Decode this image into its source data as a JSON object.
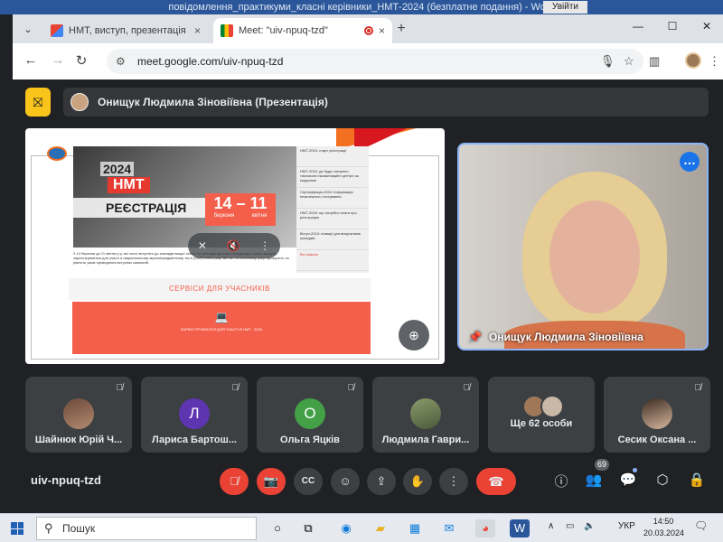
{
  "word": {
    "title": "повідомлення_практикуми_класні керівники_НМТ-2024 (безплатне подання) - Word",
    "signin": "Увійти"
  },
  "browser": {
    "tabs": [
      {
        "title": "НМТ, виступ, презентація - о.а",
        "close": "×"
      },
      {
        "title": "Meet: \"uiv-npuq-tzd\"",
        "close": "×"
      }
    ],
    "url": "meet.google.com/uiv-npuq-tzd",
    "window_controls": [
      "—",
      "☐",
      "✕"
    ]
  },
  "meet": {
    "presenter": "Онищук Людмила Зіновіївна (Презентація)",
    "slide": {
      "year": "2024",
      "nmt": "НМТ",
      "registration": "РЕЄСТРАЦІЯ",
      "dates": "14 – 11",
      "month_from": "березня",
      "month_to": "квітня",
      "side_items": [
        "НМТ-2024: старт реєстрації",
        "НМТ-2024: де буде створено тимчасові екзаменаційні центри за кордоном",
        "Сертифікація-2024: інформація незалежного тестування",
        "НМТ-2024: що потрібно знати про реєстрацію",
        "Вступ-2024: новації для випускників коледжів",
        "Всі новини"
      ],
      "paragraph": "З 14 березня до 11 квітня р.р, всі охочі вступити до закладів вищої освіти та закладів фахової передвищої освіти можуть зареєструватися для участі в національному мультипредметному тесті (НМТ) 2024 року. Він за - в поточному році, прозорість та рівність умов проведення вступних кампаній.",
      "services": "СЕРВІСИ ДЛЯ УЧАСНИКІВ",
      "cta": "ЗАРЕЄСТРУВАТИСЯ ДЛЯ УЧАСТІ В НМТ - 2024"
    },
    "speaker": "Онищук Людмила Зіновіївна",
    "participants": [
      {
        "name": "Шайнюк Юрій Ч...",
        "initial": "",
        "color": "#7a5a48"
      },
      {
        "name": "Лариса Бартош...",
        "initial": "Л",
        "color": "#5e35b1"
      },
      {
        "name": "Ольга Яцків",
        "initial": "О",
        "color": "#43a047"
      },
      {
        "name": "Людмила Гаври...",
        "initial": "",
        "color": "#6d7b52"
      },
      {
        "name": "Ще 62 особи",
        "initial": "",
        "color": "#8d6e63"
      },
      {
        "name": "Сесик Оксана ...",
        "initial": "",
        "color": "#b07a6a"
      }
    ],
    "meeting_code": "uiv-npuq-tzd",
    "people_count": "69"
  },
  "taskbar": {
    "search": "Пошук",
    "lang": "УКР",
    "time": "14:50",
    "date": "20.03.2024"
  }
}
